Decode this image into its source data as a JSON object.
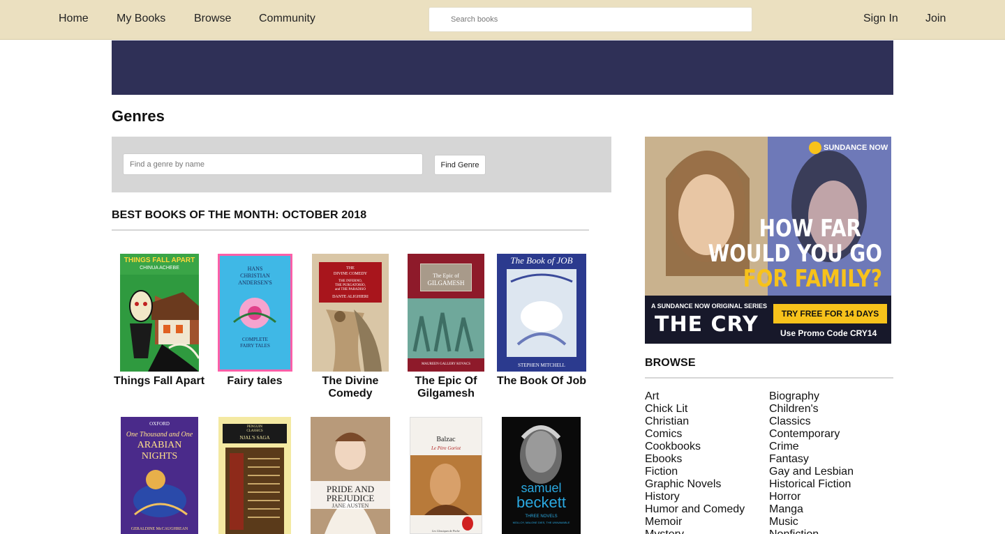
{
  "nav": {
    "home": "Home",
    "my_books": "My Books",
    "browse": "Browse",
    "community": "Community",
    "search_placeholder": "Search books",
    "sign_in": "Sign In",
    "join": "Join"
  },
  "page": {
    "title": "Genres",
    "genre_search_placeholder": "Find a genre by name",
    "find_genre_button": "Find Genre"
  },
  "best_books": {
    "heading": "BEST BOOKS OF THE MONTH: OCTOBER 2018",
    "books": [
      {
        "title": "Things Fall Apart",
        "cover_text": [
          "THINGS FALL APART",
          "CHINUA ACHEBE"
        ]
      },
      {
        "title": "Fairy tales",
        "cover_text": [
          "HANS",
          "CHRISTIAN",
          "ANDERSEN'S",
          "COMPLETE",
          "FAIRY TALES"
        ]
      },
      {
        "title": "The Divine Comedy",
        "cover_text": [
          "THE",
          "DIVINE COMEDY",
          "THE INFERNO,",
          "THE PURGATORIO,",
          "and THE PARADISO",
          "DANTE ALIGHIERI"
        ]
      },
      {
        "title": "The Epic Of Gilgamesh",
        "cover_text": [
          "The Epic of",
          "GILGAMESH",
          "MAUREEN GALLERY KOVACS"
        ]
      },
      {
        "title": "The Book Of Job",
        "cover_text": [
          "The Book of JOB",
          "STEPHEN MITCHELL"
        ]
      },
      {
        "title": "",
        "cover_text": [
          "OXFORD",
          "One Thousand and One",
          "ARABIAN NIGHTS",
          "GERALDINE McCAUGHREAN"
        ]
      },
      {
        "title": "",
        "cover_text": [
          "PENGUIN",
          "CLASSICS",
          "NJAL'S SAGA"
        ]
      },
      {
        "title": "",
        "cover_text": [
          "PRIDE AND",
          "PREJUDICE",
          "JANE AUSTEN"
        ]
      },
      {
        "title": "",
        "cover_text": [
          "Balzac",
          "Le Père Goriot",
          "Les Classiques de Poche"
        ]
      },
      {
        "title": "",
        "cover_text": [
          "samuel",
          "beckett",
          "THREE NOVELS",
          "MOLLOY, MALONE DIES, THE UNNAMABLE"
        ]
      }
    ]
  },
  "ad": {
    "brand": "SUNDANCE NOW",
    "headline_1": "HOW FAR",
    "headline_2": "WOULD YOU GO",
    "headline_3": "FOR FAMILY?",
    "series_line": "A SUNDANCE NOW ORIGINAL SERIES",
    "show": "THE CRY",
    "cta": "TRY FREE FOR 14 DAYS",
    "promo": "Use Promo Code CRY14"
  },
  "browse": {
    "heading": "BROWSE",
    "col1": [
      "Art",
      "Chick Lit",
      "Christian",
      "Comics",
      "Cookbooks",
      "Ebooks",
      "Fiction",
      "Graphic Novels",
      "History",
      "Humor and Comedy",
      "Memoir",
      "Mystery"
    ],
    "col2": [
      "Biography",
      "Children's",
      "Classics",
      "Contemporary",
      "Crime",
      "Fantasy",
      "Gay and Lesbian",
      "Historical Fiction",
      "Horror",
      "Manga",
      "Music",
      "Nonfiction"
    ]
  },
  "colors": {
    "nav_bg": "#ebe0c0",
    "banner_bg": "#2f3057",
    "panel_bg": "#d6d6d6",
    "ad_yellow": "#f7c21b"
  }
}
